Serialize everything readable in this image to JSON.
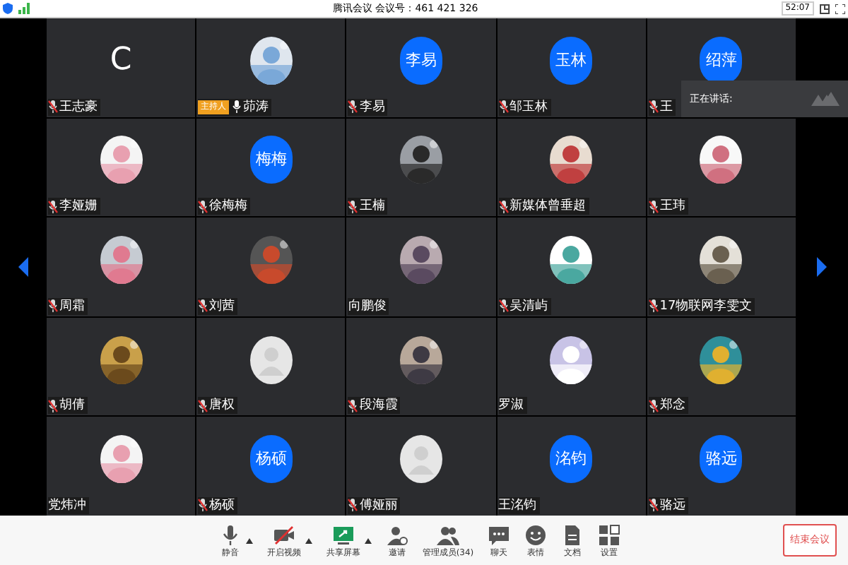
{
  "title_bar": {
    "title": "腾讯会议 会议号：461 421 326",
    "timer": "52:07"
  },
  "tiles": [
    {
      "avatar": {
        "kind": "letter",
        "text": "C"
      },
      "name": "王志豪",
      "mic": {
        "muted": true
      }
    },
    {
      "name": "茆涛",
      "mic": {
        "muted": false
      },
      "badge": "主持人"
    },
    {
      "avatar": {
        "kind": "initials",
        "text": "李易"
      },
      "name": "李易",
      "mic": {
        "muted": true
      }
    },
    {
      "avatar": {
        "kind": "initials",
        "text": "玉林"
      },
      "name": "邹玉林",
      "mic": {
        "muted": true
      }
    },
    {
      "avatar": {
        "kind": "initials",
        "text": "绍萍"
      },
      "name": "王",
      "mic": {
        "muted": true
      }
    },
    {
      "name": "李娅姗",
      "mic": {
        "muted": true
      }
    },
    {
      "avatar": {
        "kind": "initials",
        "text": "梅梅"
      },
      "name": "徐梅梅",
      "mic": {
        "muted": true
      }
    },
    {
      "name": "王楠",
      "mic": {
        "muted": true
      }
    },
    {
      "name": "新媒体曾垂超",
      "mic": {
        "muted": true
      }
    },
    {
      "name": "王玮",
      "mic": {
        "muted": true
      }
    },
    {
      "name": "周霜",
      "mic": {
        "muted": true
      }
    },
    {
      "name": "刘茜",
      "mic": {
        "muted": true
      }
    },
    {
      "name": "向鹏俊"
    },
    {
      "name": "吴清屿",
      "mic": {
        "muted": true
      }
    },
    {
      "name": "17物联网李雯文",
      "mic": {
        "muted": true
      }
    },
    {
      "name": "胡倩",
      "mic": {
        "muted": true
      }
    },
    {
      "avatar": {
        "kind": "default"
      },
      "name": "唐权",
      "mic": {
        "muted": true
      }
    },
    {
      "name": "段海霞",
      "mic": {
        "muted": true
      }
    },
    {
      "name": "罗淑"
    },
    {
      "name": "郑念",
      "mic": {
        "muted": true
      }
    },
    {
      "name": "党炜冲"
    },
    {
      "avatar": {
        "kind": "initials",
        "text": "杨硕"
      },
      "name": "杨硕",
      "mic": {
        "muted": true
      }
    },
    {
      "avatar": {
        "kind": "default"
      },
      "name": "傅娅丽",
      "mic": {
        "muted": true
      }
    },
    {
      "avatar": {
        "kind": "initials",
        "text": "洺钧"
      },
      "name": "王洺钧"
    },
    {
      "avatar": {
        "kind": "initials",
        "text": "骆远"
      },
      "name": "骆远",
      "mic": {
        "muted": true
      }
    }
  ],
  "speaking_popup": {
    "label": "正在讲话:"
  },
  "toolbar": [
    {
      "kind": "mic",
      "label": "静音",
      "caret": true
    },
    {
      "kind": "video",
      "label": "开启视频",
      "caret": true
    },
    {
      "kind": "share",
      "label": "共享屏幕",
      "caret": true
    },
    {
      "kind": "invite",
      "label": "邀请",
      "caret": false
    },
    {
      "kind": "members",
      "label": "管理成员(34)",
      "caret": false
    },
    {
      "kind": "chat",
      "label": "聊天",
      "caret": false
    },
    {
      "kind": "emoji",
      "label": "表情",
      "caret": false
    },
    {
      "kind": "doc",
      "label": "文档",
      "caret": false
    },
    {
      "kind": "settings",
      "label": "设置",
      "caret": false
    }
  ],
  "end_button": "结束会议"
}
